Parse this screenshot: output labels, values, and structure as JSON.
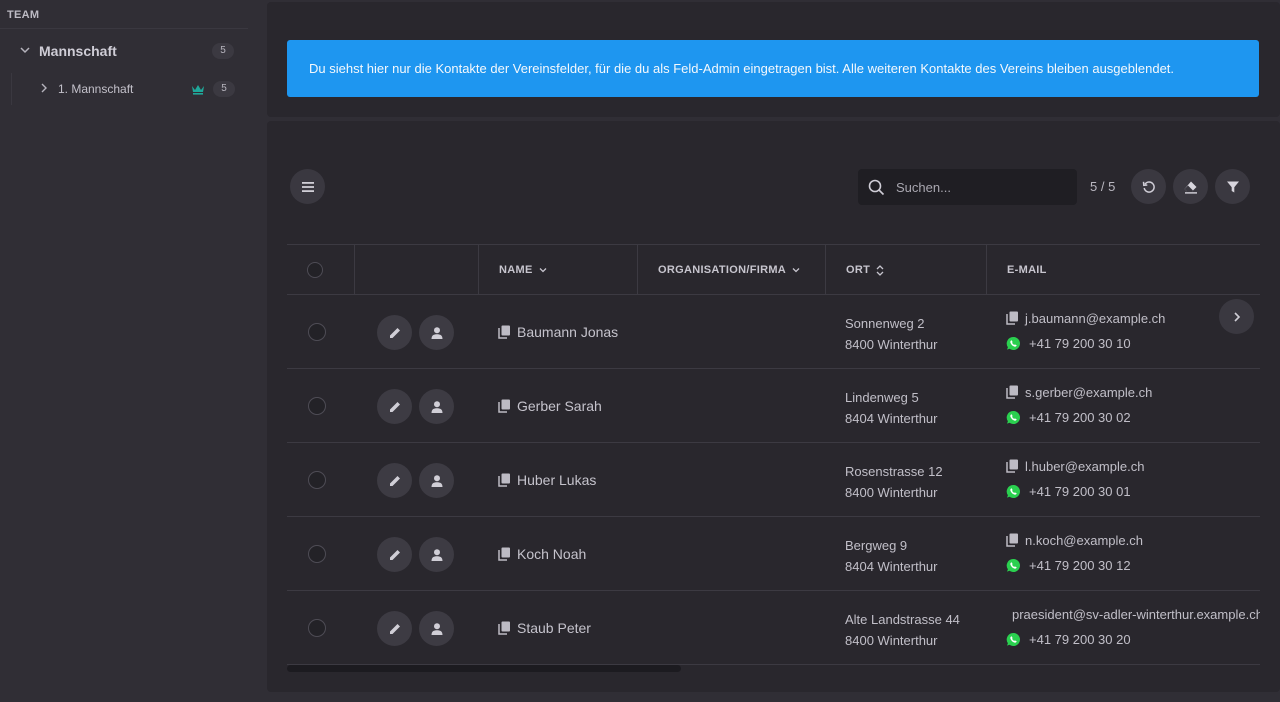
{
  "sidebar": {
    "header": "TEAM",
    "group": {
      "label": "Mannschaft",
      "count": "5"
    },
    "item": {
      "label": "1. Mannschaft",
      "count": "5"
    }
  },
  "info": {
    "text": "Du siehst hier nur die Kontakte der Vereinsfelder, für die du als Feld-Admin eingetragen bist. Alle weiteren Kontakte des Vereins bleiben ausgeblendet."
  },
  "toolbar": {
    "search_placeholder": "Suchen...",
    "count": "5 / 5"
  },
  "table": {
    "columns": {
      "name": "NAME",
      "org": "ORGANISATION/FIRMA",
      "ort": "ORT",
      "email": "E-MAIL"
    },
    "rows": [
      {
        "name": "Baumann Jonas",
        "street": "Sonnenweg 2",
        "city": "8400 Winterthur",
        "email": "j.baumann@example.ch",
        "phone": "+41 79 200 30 10"
      },
      {
        "name": "Gerber Sarah",
        "street": "Lindenweg 5",
        "city": "8404 Winterthur",
        "email": "s.gerber@example.ch",
        "phone": "+41 79 200 30 02"
      },
      {
        "name": "Huber Lukas",
        "street": "Rosenstrasse 12",
        "city": "8400 Winterthur",
        "email": "l.huber@example.ch",
        "phone": "+41 79 200 30 01"
      },
      {
        "name": "Koch Noah",
        "street": "Bergweg 9",
        "city": "8404 Winterthur",
        "email": "n.koch@example.ch",
        "phone": "+41 79 200 30 12"
      },
      {
        "name": "Staub Peter",
        "street": "Alte Landstrasse 44",
        "city": "8400 Winterthur",
        "email": "praesident@sv-adler-winterthur.example.ch",
        "phone": "+41 79 200 30 20"
      }
    ]
  },
  "colors": {
    "info_bg": "#1e96f0",
    "crown": "#1fa89a",
    "whatsapp": "#2ad04f",
    "panel": "#29272d",
    "background": "#302e35"
  },
  "icons": [
    "chevron-down-icon",
    "chevron-right-icon",
    "crown-icon",
    "menu-icon",
    "search-icon",
    "reset-icon",
    "eraser-icon",
    "filter-icon",
    "edit-icon",
    "person-icon",
    "copy-icon",
    "whatsapp-icon"
  ]
}
